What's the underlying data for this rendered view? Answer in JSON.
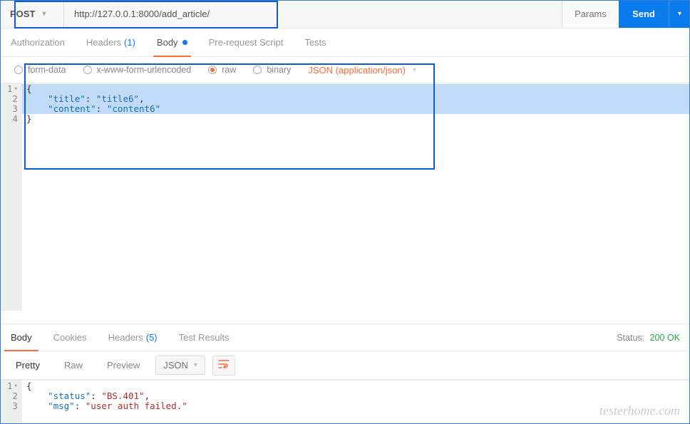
{
  "request": {
    "method": "POST",
    "url": "http://127.0.0.1:8000/add_article/",
    "params_label": "Params",
    "send_label": "Send"
  },
  "tabs": {
    "authorization": "Authorization",
    "headers": "Headers",
    "headers_count": "(1)",
    "body": "Body",
    "prerequest": "Pre-request Script",
    "tests": "Tests"
  },
  "body_types": {
    "formdata": "form-data",
    "urlencoded": "x-www-form-urlencoded",
    "raw": "raw",
    "binary": "binary",
    "content_type": "JSON (application/json)"
  },
  "request_body": {
    "l1": "{",
    "l2_key": "\"title\"",
    "l2_val": "\"title6\"",
    "l3_key": "\"content\"",
    "l3_val": "\"content6\"",
    "l4": "}"
  },
  "response": {
    "tabs": {
      "body": "Body",
      "cookies": "Cookies",
      "headers": "Headers",
      "headers_count": "(5)",
      "tests": "Test Results"
    },
    "status_label": "Status:",
    "status_value": "200 OK",
    "view": {
      "pretty": "Pretty",
      "raw": "Raw",
      "preview": "Preview",
      "format": "JSON"
    },
    "body": {
      "l1": "{",
      "l2_key": "\"status\"",
      "l2_val": "\"BS.401\"",
      "l3_key": "\"msg\"",
      "l3_val": "\"user auth failed.\""
    }
  },
  "watermark": "testerhome.com"
}
